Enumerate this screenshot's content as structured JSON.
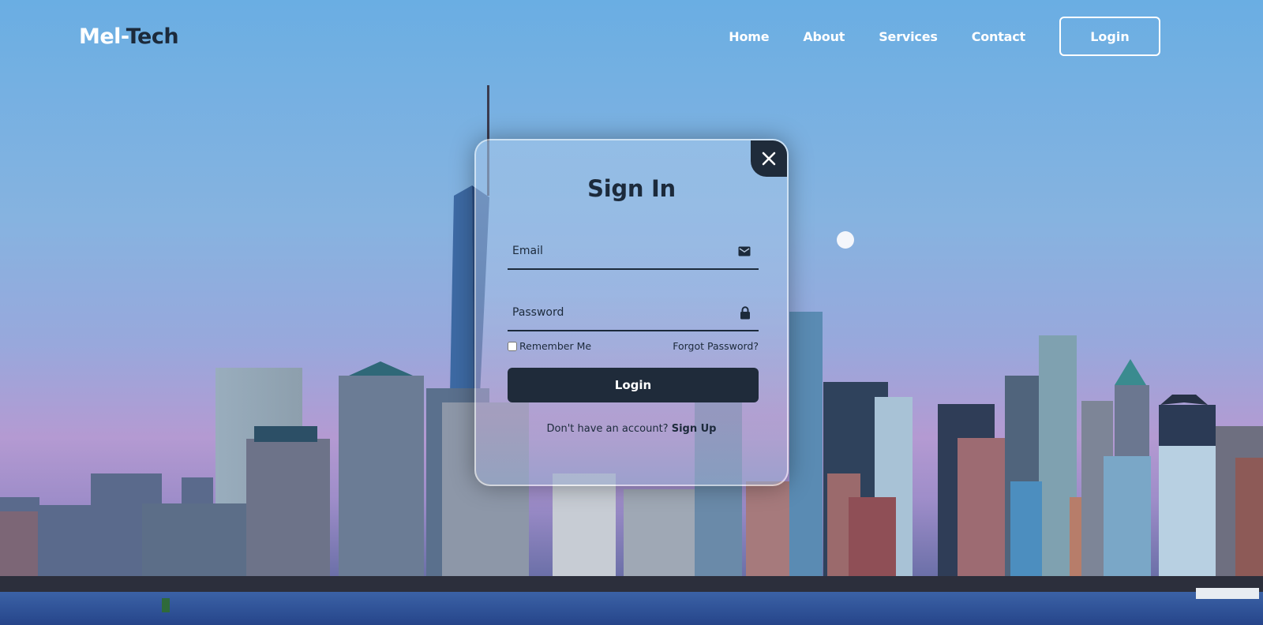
{
  "brand": {
    "part1": "Mel-",
    "part2": "Tech"
  },
  "nav": {
    "items": [
      "Home",
      "About",
      "Services",
      "Contact"
    ],
    "login_label": "Login"
  },
  "modal": {
    "title": "Sign In",
    "email_placeholder": "Email",
    "password_placeholder": "Password",
    "remember_label": "Remember Me",
    "remember_checked": false,
    "forgot_label": "Forgot Password?",
    "login_label": "Login",
    "signup_prompt": "Don't have an account?",
    "signup_link": "Sign Up"
  },
  "icons": {
    "close": "close-icon",
    "email": "envelope-icon",
    "password": "lock-icon"
  },
  "colors": {
    "dark": "#1f2b3a",
    "text_dark": "#1c2a3b",
    "white": "#ffffff"
  }
}
